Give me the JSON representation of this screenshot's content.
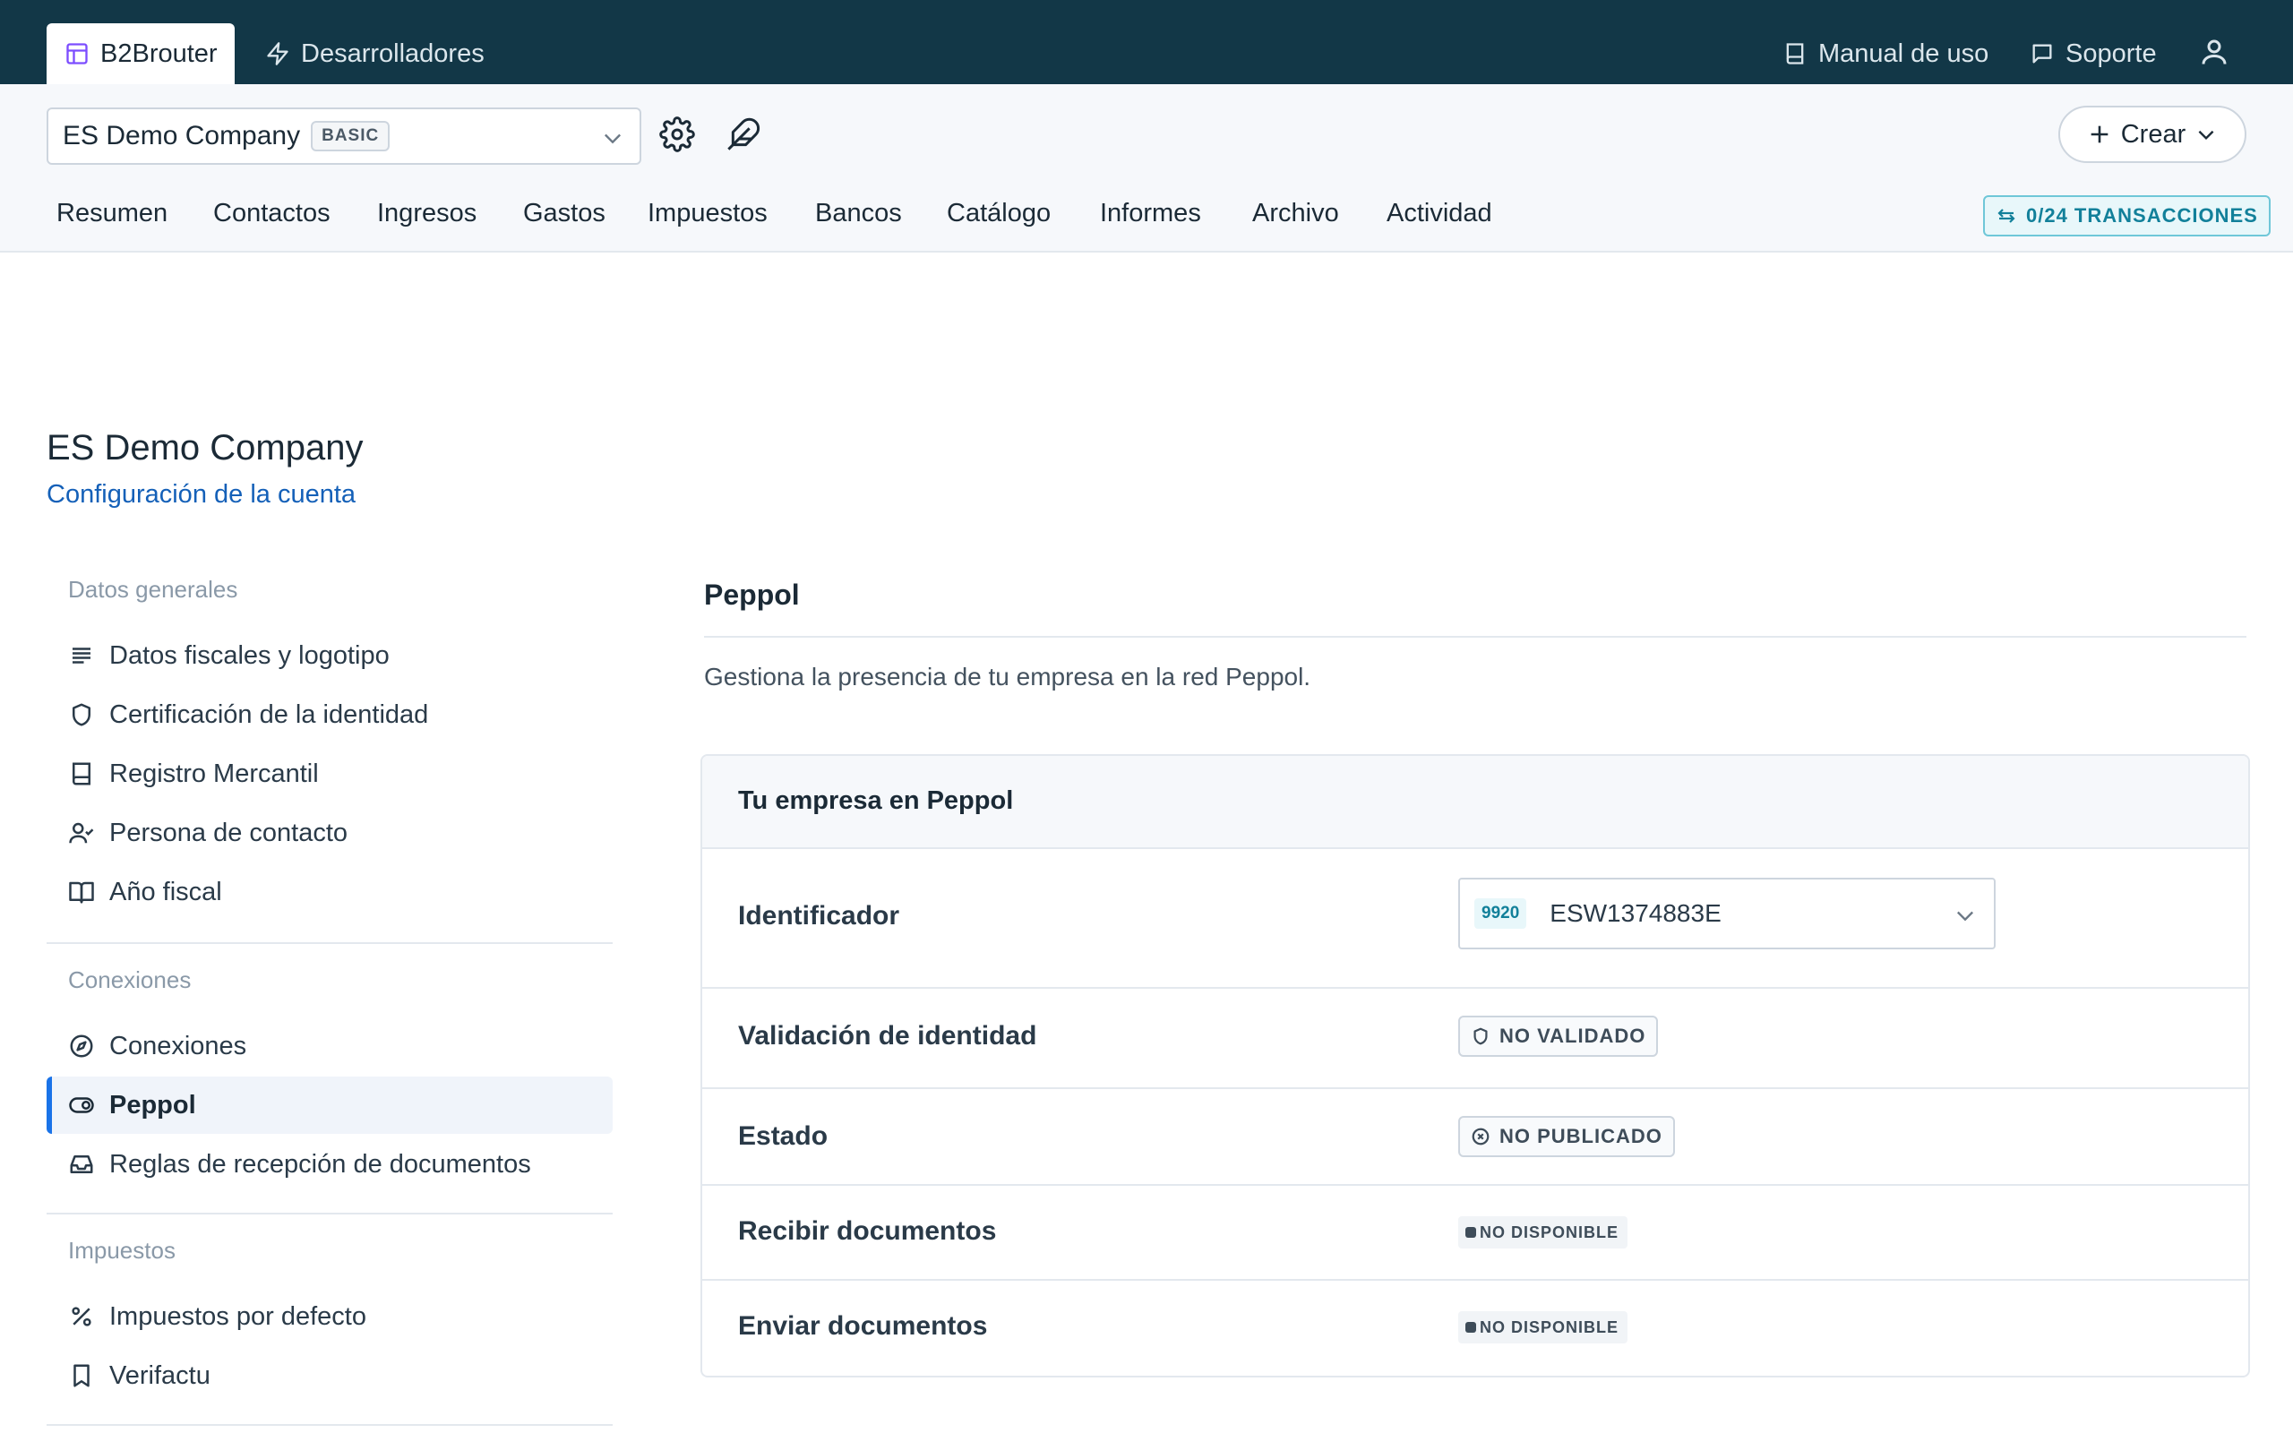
{
  "topbar": {
    "app_tab": "B2Brouter",
    "dev_tab": "Desarrolladores",
    "manual": "Manual de uso",
    "support": "Soporte"
  },
  "subheader": {
    "company_name": "ES Demo Company",
    "plan": "BASIC",
    "create_label": "Crear",
    "transactions": "0/24 TRANSACCIONES",
    "nav": [
      "Resumen",
      "Contactos",
      "Ingresos",
      "Gastos",
      "Impuestos",
      "Bancos",
      "Catálogo",
      "Informes",
      "Archivo",
      "Actividad"
    ]
  },
  "page": {
    "title": "ES Demo Company",
    "subtitle": "Configuración de la cuenta"
  },
  "sidebar": {
    "sections": [
      {
        "title": "Datos generales",
        "items": [
          "Datos fiscales y logotipo",
          "Certificación de la identidad",
          "Registro Mercantil",
          "Persona de contacto",
          "Año fiscal"
        ]
      },
      {
        "title": "Conexiones",
        "items": [
          "Conexiones",
          "Peppol",
          "Reglas de recepción de documentos"
        ]
      },
      {
        "title": "Impuestos",
        "items": [
          "Impuestos por defecto",
          "Verifactu"
        ]
      }
    ]
  },
  "content": {
    "title": "Peppol",
    "description": "Gestiona la presencia de tu empresa en la red Peppol.",
    "card_title": "Tu empresa en Peppol",
    "rows": {
      "identifier_label": "Identificador",
      "identifier_scheme": "9920",
      "identifier_value": "ESW1374883E",
      "validation_label": "Validación de identidad",
      "validation_status": "NO VALIDADO",
      "state_label": "Estado",
      "state_status": "NO PUBLICADO",
      "receive_label": "Recibir documentos",
      "receive_status": "NO DISPONIBLE",
      "send_label": "Enviar documentos",
      "send_status": "NO DISPONIBLE"
    }
  },
  "colors": {
    "topbar": "#123747",
    "accent": "#1a73e8",
    "link": "#1460b8",
    "teal": "#12809a"
  }
}
